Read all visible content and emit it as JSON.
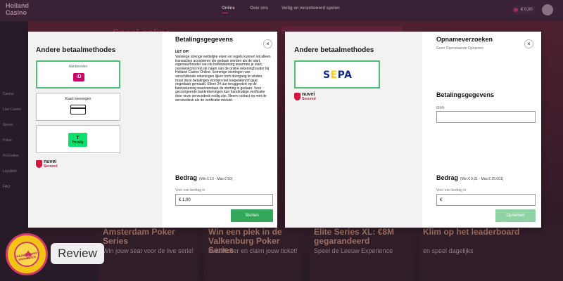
{
  "site": {
    "logo": "Holland Casino",
    "nav": [
      "Online",
      "Over ons",
      "Veilig en verantwoord spelen"
    ],
    "balance": "€ 0,00",
    "sidebar": [
      "Casino",
      "Live Casino",
      "Sports",
      "Poker",
      "Promoties",
      "Loyaliteit",
      "FAQ"
    ],
    "headline": "Speel online",
    "cards": [
      {
        "title": "Amsterdam Poker Series",
        "sub": "Win jouw seat voor de live serie!"
      },
      {
        "title": "Win een plek in de Valkenburg Poker Series",
        "sub": "Kwalificeer en claim jouw ticket!"
      },
      {
        "title": "Elite Series XL: €8M gegarandeerd",
        "sub": "Speel de Leeuw Experience"
      },
      {
        "title": "Klim op het leaderboard",
        "sub": "en speel dagelijks"
      }
    ]
  },
  "deposit_modal": {
    "methods_heading": "Andere betaalmethodes",
    "methods": [
      {
        "caption": "Aanbevolen",
        "icon": "ideal-logo",
        "logo_text": "iD",
        "selected": true
      },
      {
        "caption": "Kaart toevoegen",
        "icon": "credit-card-icon",
        "selected": false
      },
      {
        "caption": "",
        "icon": "trustly-logo",
        "logo_text": "Trustly",
        "selected": false
      }
    ],
    "nuvei": {
      "word": "nuvei",
      "secured": "Secured"
    },
    "title": "Betalingsgegevens",
    "close": "×",
    "notice_title": "LET OP!",
    "notice_body": "Vanwege strenge wettelijke eisen en regels kunnen wij alleen transacties accepteren die gedaan worden als de start, eigenaar/houder van de bankrekening waarmee je start, overeenkomt met de naam van de online rekeninghouder bij Holland Casino Online. Sommige stortingen van verschillende rekeningen lijken toch doorgang te vinden, maar deze betalingen worden niet toegelaten/of gaat ongedaan gemaakt. Eiken 24 uur teruggestort op de bankrekening waarvandaan de storting is gedaan. Voor gecorrigeerde bankrekeningen kan handmatige verificatie door onze servicedesk nodig zijn. Neem contact op met de servicedesk als de verificatie mislukt.",
    "amount_title": "Bedrag",
    "amount_range": "(Min.€ 10 - Max.€ 50)",
    "amount_label": "Voer een bedrag in",
    "amount_value": "€ 1,00",
    "submit": "Storten"
  },
  "withdraw_modal": {
    "methods_heading": "Andere betaalmethodes",
    "method_logo": "SEPA",
    "nuvei": {
      "word": "nuvei",
      "secured": "Secured"
    },
    "title": "Opnameverzoeken",
    "subtitle": "Geen Openstaande Opnames",
    "close": "×",
    "details_title": "Betalingsgegevens",
    "iban_label": "IBAN",
    "iban_value": "",
    "amount_title": "Bedrag",
    "amount_range": "(Min.€ 0,01 - Max.€ 25.001)",
    "amount_label": "Voer een bedrag in",
    "amount_value": "€",
    "submit": "Opnemen"
  },
  "review": {
    "seal_text": "ONLINE CASINO GRONINGEN",
    "label": "Review"
  },
  "colors": {
    "accent_green": "#33a85a",
    "disabled_green": "#8fd2a4",
    "nuvei_red": "#d6163e",
    "brand_pink": "#d13a6a"
  }
}
